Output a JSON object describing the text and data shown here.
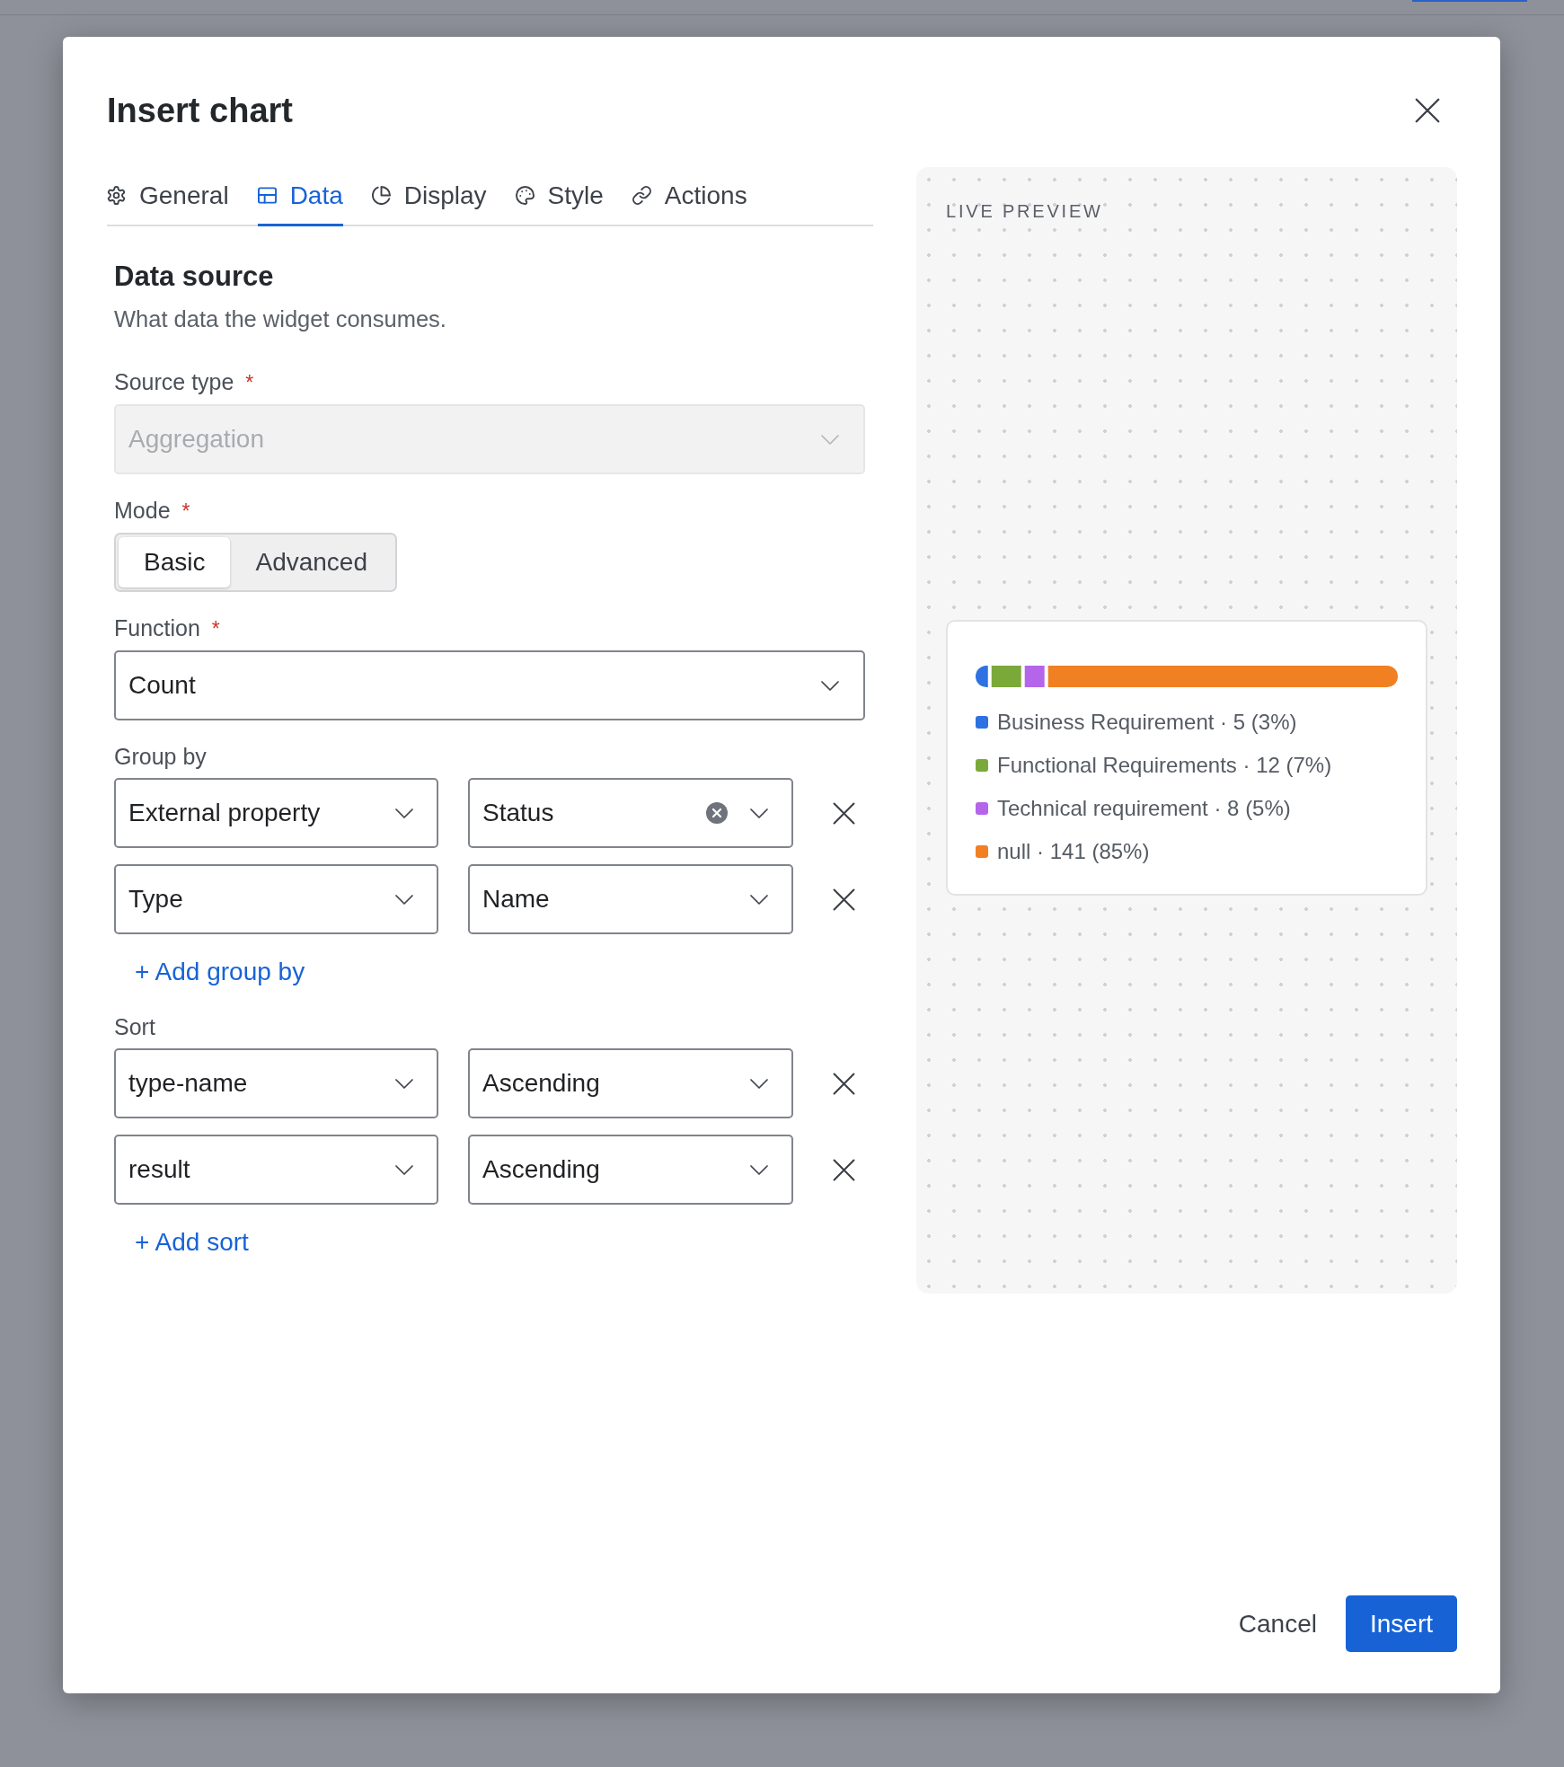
{
  "dialog": {
    "title": "Insert chart"
  },
  "tabs": [
    {
      "label": "General",
      "selected": false
    },
    {
      "label": "Data",
      "selected": true
    },
    {
      "label": "Display",
      "selected": false
    },
    {
      "label": "Style",
      "selected": false
    },
    {
      "label": "Actions",
      "selected": false
    }
  ],
  "section": {
    "title": "Data source",
    "description": "What data the widget consumes."
  },
  "source_type": {
    "label": "Source type",
    "required_mark": "*",
    "value": "Aggregation",
    "disabled": true
  },
  "mode": {
    "label": "Mode",
    "required_mark": "*",
    "options": [
      {
        "label": "Basic",
        "selected": true
      },
      {
        "label": "Advanced",
        "selected": false
      }
    ]
  },
  "function": {
    "label": "Function",
    "required_mark": "*",
    "value": "Count",
    "disabled": false
  },
  "group_by": {
    "label": "Group by",
    "rows": [
      {
        "field": "External property",
        "value": "Status",
        "clearable": true
      },
      {
        "field": "Type",
        "value": "Name",
        "clearable": false
      }
    ],
    "add_label": "+ Add group by"
  },
  "sort": {
    "label": "Sort",
    "rows": [
      {
        "field": "type-name",
        "order": "Ascending"
      },
      {
        "field": "result",
        "order": "Ascending"
      }
    ],
    "add_label": "+ Add sort"
  },
  "preview": {
    "label": "LIVE PREVIEW",
    "legend": [
      {
        "label": "Business Requirement · 5 (3%)",
        "color": "#2d71e2"
      },
      {
        "label": "Functional Requirements · 12 (7%)",
        "color": "#7aa93a"
      },
      {
        "label": "Technical requirement · 8 (5%)",
        "color": "#b565ea"
      },
      {
        "label": "null · 141 (85%)",
        "color": "#f08022"
      }
    ]
  },
  "footer": {
    "cancel": "Cancel",
    "insert": "Insert"
  }
}
